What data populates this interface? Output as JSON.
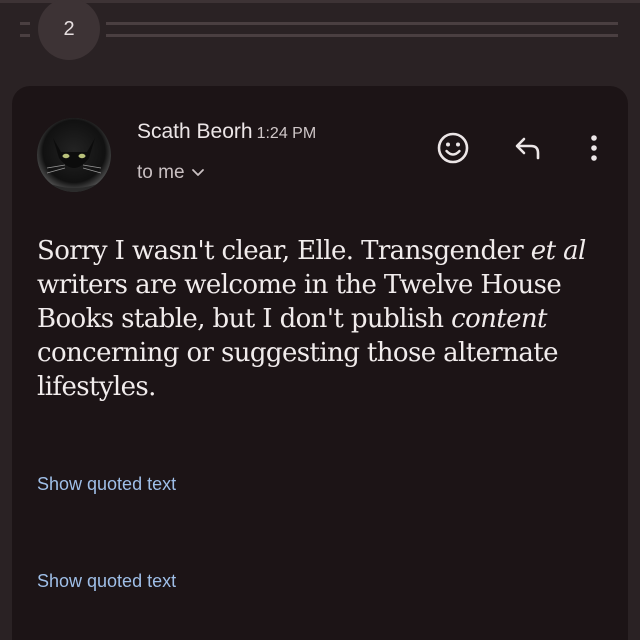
{
  "thread": {
    "collapsed_count": "2"
  },
  "message": {
    "sender_name": "Scath Beorh",
    "time": "1:24 PM",
    "recipient_label": "to me",
    "body": {
      "seg1": "Sorry I wasn't clear, Elle. Transgender ",
      "em1": "et al",
      "seg2": " writers are welcome in the Twelve House Books stable, but I don't publish ",
      "em2": "content",
      "seg3": " concerning or suggesting those alternate lifestyles."
    },
    "quoted_links": [
      "Show quoted text",
      "Show quoted text"
    ]
  },
  "icons": {
    "emoji": "emoji-react-icon",
    "reply": "reply-icon",
    "more": "more-vert-icon",
    "chevron": "chevron-down-icon"
  },
  "colors": {
    "background": "#2a2224",
    "card": "#1c1416",
    "link": "#9fbfe8",
    "text": "#f1ecec"
  }
}
